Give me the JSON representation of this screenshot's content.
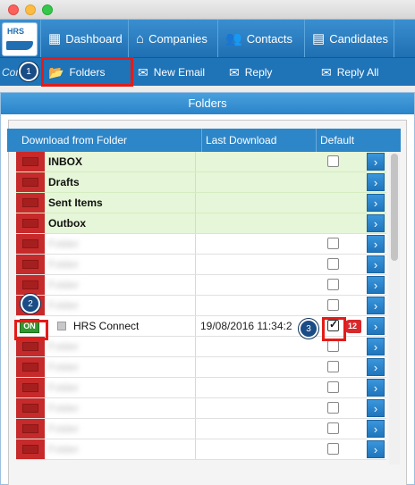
{
  "topnav": {
    "logo": "HRS",
    "items": [
      {
        "label": "Dashboard",
        "icon": "grid-icon"
      },
      {
        "label": "Companies",
        "icon": "home-icon"
      },
      {
        "label": "Contacts",
        "icon": "people-icon"
      },
      {
        "label": "Candidates",
        "icon": "id-card-icon"
      }
    ]
  },
  "toolbar": {
    "left_label": "Con",
    "folders_label": "Folders",
    "new_email_label": "New Email",
    "reply_label": "Reply",
    "reply_all_label": "Reply All"
  },
  "dialog": {
    "title": "Folders",
    "columns": {
      "folder": "Download from Folder",
      "last": "Last Download",
      "default": "Default"
    },
    "rows": [
      {
        "name": "INBOX",
        "date": "",
        "checkbox": true,
        "style": "green"
      },
      {
        "name": "Drafts",
        "date": "",
        "checkbox": false,
        "style": "green"
      },
      {
        "name": "Sent Items",
        "date": "",
        "checkbox": false,
        "style": "green"
      },
      {
        "name": "Outbox",
        "date": "",
        "checkbox": false,
        "style": "green"
      },
      {
        "name": "Folder",
        "date": "",
        "checkbox": true,
        "style": "blur"
      },
      {
        "name": "Folder",
        "date": "",
        "checkbox": true,
        "style": "blur"
      },
      {
        "name": "Folder",
        "date": "",
        "checkbox": true,
        "style": "blur"
      },
      {
        "name": "Folder",
        "date": "",
        "checkbox": true,
        "style": "blur"
      },
      {
        "name": "HRS Connect",
        "date": "19/08/2016 11:34:2",
        "checkbox": true,
        "checked": true,
        "badge": "12",
        "on_label": "ON",
        "style": "active"
      },
      {
        "name": "Folder",
        "date": "",
        "checkbox": true,
        "style": "blur"
      },
      {
        "name": "Folder",
        "date": "",
        "checkbox": true,
        "style": "blur"
      },
      {
        "name": "Folder",
        "date": "",
        "checkbox": true,
        "style": "blur"
      },
      {
        "name": "Folder",
        "date": "",
        "checkbox": true,
        "style": "blur"
      },
      {
        "name": "Folder",
        "date": "",
        "checkbox": true,
        "style": "blur"
      },
      {
        "name": "Folder",
        "date": "",
        "checkbox": true,
        "style": "blur"
      }
    ]
  },
  "markers": [
    "1",
    "2",
    "3"
  ],
  "colors": {
    "nav": "#1f6fb2",
    "highlight": "#e41b17",
    "marker": "#1a4c86",
    "on": "#2f9a2f",
    "inactive": "#c62a2a"
  }
}
